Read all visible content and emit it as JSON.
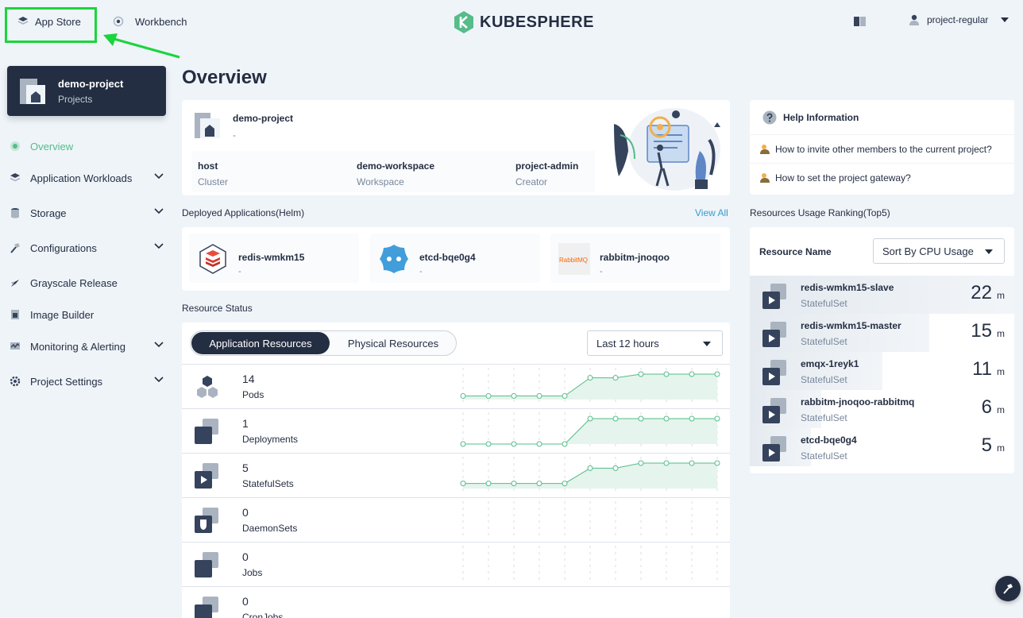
{
  "header": {
    "app_store": "App Store",
    "workbench": "Workbench",
    "logo_text": "KUBESPHERE",
    "user": "project-regular"
  },
  "sidebar": {
    "project_name": "demo-project",
    "project_type": "Projects",
    "items": [
      {
        "label": "Overview",
        "icon": "overview-icon",
        "active": true,
        "expandable": false
      },
      {
        "label": "Application Workloads",
        "icon": "layers-icon",
        "expandable": true
      },
      {
        "label": "Storage",
        "icon": "database-icon",
        "expandable": true
      },
      {
        "label": "Configurations",
        "icon": "hammer-icon",
        "expandable": true
      },
      {
        "label": "Grayscale Release",
        "icon": "bird-icon",
        "expandable": false
      },
      {
        "label": "Image Builder",
        "icon": "image-builder-icon",
        "expandable": false
      },
      {
        "label": "Monitoring & Alerting",
        "icon": "monitor-icon",
        "expandable": true
      },
      {
        "label": "Project Settings",
        "icon": "gear-icon",
        "expandable": true
      }
    ]
  },
  "main": {
    "title": "Overview",
    "project": {
      "name": "demo-project",
      "desc": "-",
      "fields": [
        {
          "value": "host",
          "label": "Cluster"
        },
        {
          "value": "demo-workspace",
          "label": "Workspace"
        },
        {
          "value": "project-admin",
          "label": "Creator"
        }
      ]
    },
    "deployed_label": "Deployed Applications(Helm)",
    "view_all": "View All",
    "apps": [
      {
        "name": "redis-wmkm15",
        "desc": "-",
        "icon": "redis-icon"
      },
      {
        "name": "etcd-bqe0g4",
        "desc": "-",
        "icon": "etcd-icon"
      },
      {
        "name": "rabbitm-jnoqoo",
        "desc": "-",
        "icon": "rabbitmq-icon",
        "icon_text": "RabbitMQ"
      }
    ],
    "resource_status_label": "Resource Status",
    "tabs": [
      "Application Resources",
      "Physical Resources"
    ],
    "time_range": "Last 12 hours",
    "resources": [
      {
        "count": "14",
        "name": "Pods",
        "trend": [
          2,
          2,
          2,
          2,
          2,
          12,
          12,
          14,
          14,
          14,
          14
        ]
      },
      {
        "count": "1",
        "name": "Deployments",
        "trend": [
          0,
          0,
          0,
          0,
          0,
          1,
          1,
          1,
          1,
          1,
          1
        ]
      },
      {
        "count": "5",
        "name": "StatefulSets",
        "trend": [
          1,
          1,
          1,
          1,
          1,
          4,
          4,
          5,
          5,
          5,
          5
        ]
      },
      {
        "count": "0",
        "name": "DaemonSets"
      },
      {
        "count": "0",
        "name": "Jobs"
      },
      {
        "count": "0",
        "name": "CronJobs"
      }
    ]
  },
  "help": {
    "title": "Help Information",
    "items": [
      "How to invite other members to the current project?",
      "How to set the project gateway?"
    ]
  },
  "ranking": {
    "title": "Resources Usage Ranking(Top5)",
    "column": "Resource Name",
    "sort": "Sort By CPU Usage",
    "unit": "m",
    "rows": [
      {
        "name": "redis-wmkm15-slave",
        "type": "StatefulSet",
        "value": "22",
        "fraction": 1.0
      },
      {
        "name": "redis-wmkm15-master",
        "type": "StatefulSet",
        "value": "15",
        "fraction": 0.68
      },
      {
        "name": "emqx-1reyk1",
        "type": "StatefulSet",
        "value": "11",
        "fraction": 0.5
      },
      {
        "name": "rabbitm-jnoqoo-rabbitmq",
        "type": "StatefulSet",
        "value": "6",
        "fraction": 0.27
      },
      {
        "name": "etcd-bqe0g4",
        "type": "StatefulSet",
        "value": "5",
        "fraction": 0.23
      }
    ]
  },
  "colors": {
    "accent": "#55bc8a",
    "dark": "#242e42",
    "highlight": "#1ad53b",
    "link": "#329dce"
  }
}
